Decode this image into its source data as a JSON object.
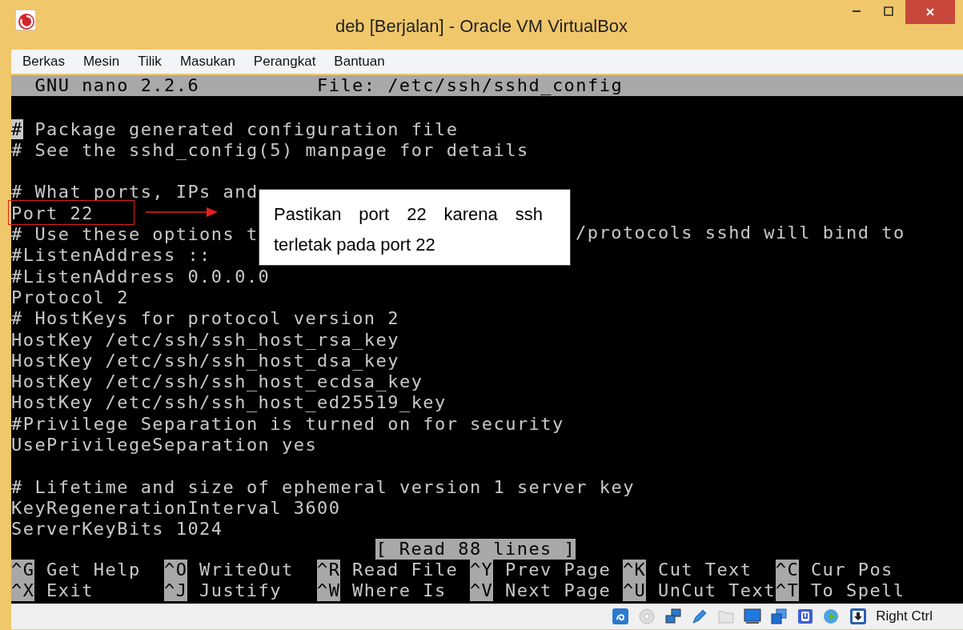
{
  "window": {
    "title": "deb [Berjalan] - Oracle VM VirtualBox"
  },
  "menu": [
    "Berkas",
    "Mesin",
    "Tilik",
    "Masukan",
    "Perangkat",
    "Bantuan"
  ],
  "nano": {
    "version": "GNU nano 2.2.6",
    "file": "File: /etc/ssh/sshd_config",
    "lines": [
      {
        "kind": "blank"
      },
      {
        "kind": "text",
        "text": "# Package generated configuration file",
        "cursor": true
      },
      {
        "kind": "text",
        "text": "# See the sshd_config(5) manpage for details",
        "cursor": false
      },
      {
        "kind": "blank"
      },
      {
        "kind": "text",
        "text": "# What ports, IPs and",
        "cursor": false
      },
      {
        "kind": "text",
        "text": "Port 22",
        "cursor": false
      },
      {
        "kind": "split",
        "text": "# Use these options t",
        "tail": "/protocols sshd will bind to",
        "cursor": false
      },
      {
        "kind": "text",
        "text": "#ListenAddress ::",
        "cursor": false
      },
      {
        "kind": "text",
        "text": "#ListenAddress 0.0.0.0",
        "cursor": false
      },
      {
        "kind": "text",
        "text": "Protocol 2",
        "cursor": false
      },
      {
        "kind": "text",
        "text": "# HostKeys for protocol version 2",
        "cursor": false
      },
      {
        "kind": "text",
        "text": "HostKey /etc/ssh/ssh_host_rsa_key",
        "cursor": false
      },
      {
        "kind": "text",
        "text": "HostKey /etc/ssh/ssh_host_dsa_key",
        "cursor": false
      },
      {
        "kind": "text",
        "text": "HostKey /etc/ssh/ssh_host_ecdsa_key",
        "cursor": false
      },
      {
        "kind": "text",
        "text": "HostKey /etc/ssh/ssh_host_ed25519_key",
        "cursor": false
      },
      {
        "kind": "text",
        "text": "#Privilege Separation is turned on for security",
        "cursor": false
      },
      {
        "kind": "text",
        "text": "UsePrivilegeSeparation yes",
        "cursor": false
      },
      {
        "kind": "blank"
      },
      {
        "kind": "text",
        "text": "# Lifetime and size of ephemeral version 1 server key",
        "cursor": false
      },
      {
        "kind": "text",
        "text": "KeyRegenerationInterval 3600",
        "cursor": false
      },
      {
        "kind": "text",
        "text": "ServerKeyBits 1024",
        "cursor": false
      }
    ],
    "message": "[ Read 88 lines ]",
    "shortcuts": [
      {
        "key": "^G",
        "label": "Get Help"
      },
      {
        "key": "^O",
        "label": "WriteOut"
      },
      {
        "key": "^R",
        "label": "Read File"
      },
      {
        "key": "^Y",
        "label": "Prev Page"
      },
      {
        "key": "^K",
        "label": "Cut Text"
      },
      {
        "key": "^C",
        "label": "Cur Pos"
      },
      {
        "key": "^X",
        "label": "Exit"
      },
      {
        "key": "^J",
        "label": "Justify"
      },
      {
        "key": "^W",
        "label": "Where Is"
      },
      {
        "key": "^V",
        "label": "Next Page"
      },
      {
        "key": "^U",
        "label": "UnCut Text"
      },
      {
        "key": "^T",
        "label": "To Spell"
      }
    ]
  },
  "annotation": {
    "text": "Pastikan port 22 karena ssh terletak pada port 22"
  },
  "status_bar": {
    "host_key": "Right Ctrl"
  }
}
